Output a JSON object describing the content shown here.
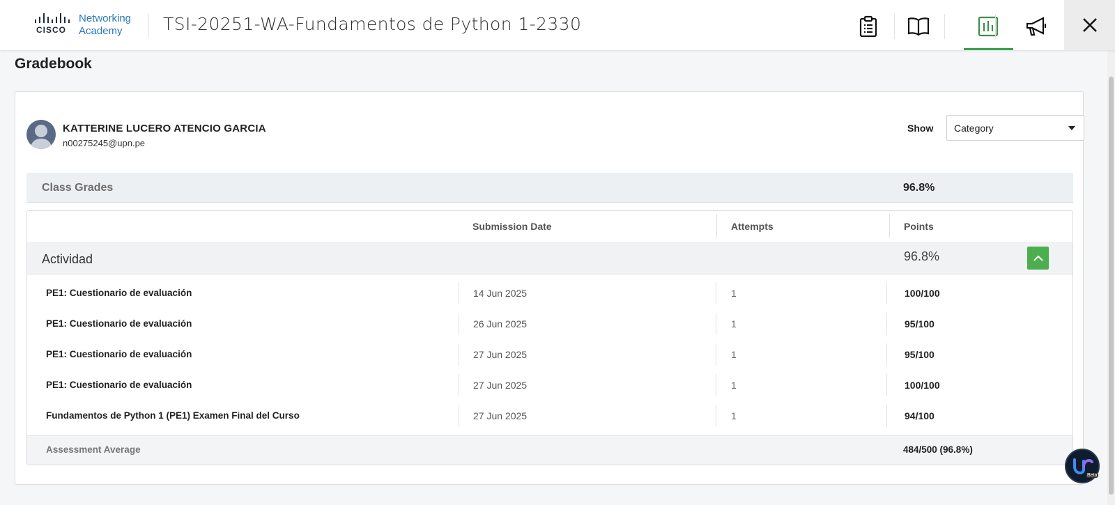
{
  "header": {
    "logo_brand": "CISCO",
    "logo_line1": "Networking",
    "logo_line2": "Academy",
    "course_title": "TSI-20251-WA-Fundamentos de Python 1-2330",
    "icons": [
      "assignments-icon",
      "book-icon",
      "gradebook-chart-icon",
      "megaphone-icon",
      "close-icon"
    ],
    "accent_color": "#3aa14b"
  },
  "page": {
    "title": "Gradebook"
  },
  "student": {
    "name": "KATTERINE LUCERO ATENCIO GARCIA",
    "email": "n00275245@upn.pe"
  },
  "filter": {
    "label": "Show",
    "selected": "Category"
  },
  "class_grades": {
    "label": "Class Grades",
    "value": "96.8%"
  },
  "table": {
    "headers": {
      "submission_date": "Submission Date",
      "attempts": "Attempts",
      "points": "Points"
    },
    "category": {
      "name": "Actividad",
      "value": "96.8%"
    },
    "rows": [
      {
        "name": "PE1: Cuestionario de evaluación",
        "date": "14 Jun 2025",
        "attempts": "1",
        "points": "100/100"
      },
      {
        "name": "PE1: Cuestionario de evaluación",
        "date": "26 Jun 2025",
        "attempts": "1",
        "points": "95/100"
      },
      {
        "name": "PE1: Cuestionario de evaluación",
        "date": "27 Jun 2025",
        "attempts": "1",
        "points": "95/100"
      },
      {
        "name": "PE1: Cuestionario de evaluación",
        "date": "27 Jun 2025",
        "attempts": "1",
        "points": "100/100"
      },
      {
        "name": "Fundamentos de Python 1 (PE1) Examen Final del Curso",
        "date": "27 Jun 2025",
        "attempts": "1",
        "points": "94/100"
      }
    ],
    "average": {
      "label": "Assessment Average",
      "value": "484/500 (96.8%)"
    }
  },
  "fab": {
    "badge": "Beta"
  }
}
